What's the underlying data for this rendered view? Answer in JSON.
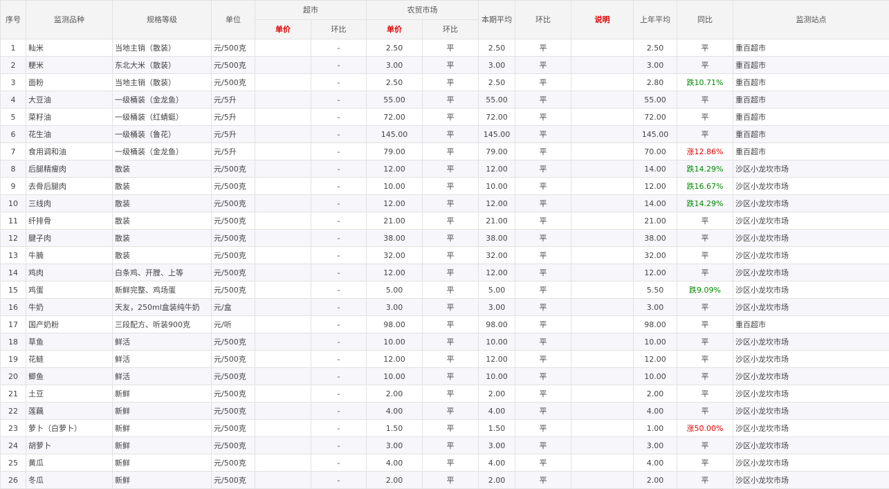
{
  "headers": {
    "seq": "序号",
    "variety": "监测品种",
    "spec": "规格等级",
    "unit": "单位",
    "supermarket": "超市",
    "farmers_market": "农贸市场",
    "current_avg": "本期平均",
    "mom": "环比",
    "note": "说明",
    "last_year_avg": "上年平均",
    "yoy": "同比",
    "station": "监测站点",
    "unit_price": "单价",
    "sub_mom": "环比"
  },
  "colors": {
    "accent_red": "#e00000",
    "down_green": "#008800",
    "header_bg": "#f4f4f4",
    "row_alt_bg": "#f6f6fb"
  },
  "rows": [
    {
      "seq": "1",
      "variety": "籼米",
      "spec": "当地主销（散装）",
      "unit": "元/500克",
      "sm_price": "",
      "sm_mom": "-",
      "fm_price": "2.50",
      "fm_mom": "平",
      "avg": "2.50",
      "mom": "平",
      "note": "",
      "ly_avg": "2.50",
      "yoy": "平",
      "yoy_dir": "flat",
      "station": "重百超市"
    },
    {
      "seq": "2",
      "variety": "粳米",
      "spec": "东北大米（散装）",
      "unit": "元/500克",
      "sm_price": "",
      "sm_mom": "-",
      "fm_price": "3.00",
      "fm_mom": "平",
      "avg": "3.00",
      "mom": "平",
      "note": "",
      "ly_avg": "3.00",
      "yoy": "平",
      "yoy_dir": "flat",
      "station": "重百超市"
    },
    {
      "seq": "3",
      "variety": "面粉",
      "spec": "当地主销（散装）",
      "unit": "元/500克",
      "sm_price": "",
      "sm_mom": "-",
      "fm_price": "2.50",
      "fm_mom": "平",
      "avg": "2.50",
      "mom": "平",
      "note": "",
      "ly_avg": "2.80",
      "yoy": "跌10.71%",
      "yoy_dir": "down",
      "station": "重百超市"
    },
    {
      "seq": "4",
      "variety": "大豆油",
      "spec": "一级桶装（金龙鱼）",
      "unit": "元/5升",
      "sm_price": "",
      "sm_mom": "-",
      "fm_price": "55.00",
      "fm_mom": "平",
      "avg": "55.00",
      "mom": "平",
      "note": "",
      "ly_avg": "55.00",
      "yoy": "平",
      "yoy_dir": "flat",
      "station": "重百超市"
    },
    {
      "seq": "5",
      "variety": "菜籽油",
      "spec": "一级桶装（红蜻蜓）",
      "unit": "元/5升",
      "sm_price": "",
      "sm_mom": "-",
      "fm_price": "72.00",
      "fm_mom": "平",
      "avg": "72.00",
      "mom": "平",
      "note": "",
      "ly_avg": "72.00",
      "yoy": "平",
      "yoy_dir": "flat",
      "station": "重百超市"
    },
    {
      "seq": "6",
      "variety": "花生油",
      "spec": "一级桶装（鲁花）",
      "unit": "元/5升",
      "sm_price": "",
      "sm_mom": "-",
      "fm_price": "145.00",
      "fm_mom": "平",
      "avg": "145.00",
      "mom": "平",
      "note": "",
      "ly_avg": "145.00",
      "yoy": "平",
      "yoy_dir": "flat",
      "station": "重百超市"
    },
    {
      "seq": "7",
      "variety": "食用调和油",
      "spec": "一级桶装（金龙鱼）",
      "unit": "元/5升",
      "sm_price": "",
      "sm_mom": "-",
      "fm_price": "79.00",
      "fm_mom": "平",
      "avg": "79.00",
      "mom": "平",
      "note": "",
      "ly_avg": "70.00",
      "yoy": "涨12.86%",
      "yoy_dir": "up",
      "station": "重百超市"
    },
    {
      "seq": "8",
      "variety": "后腿精瘦肉",
      "spec": "散装",
      "unit": "元/500克",
      "sm_price": "",
      "sm_mom": "-",
      "fm_price": "12.00",
      "fm_mom": "平",
      "avg": "12.00",
      "mom": "平",
      "note": "",
      "ly_avg": "14.00",
      "yoy": "跌14.29%",
      "yoy_dir": "down",
      "station": "沙区小龙坎市场"
    },
    {
      "seq": "9",
      "variety": "去骨后腿肉",
      "spec": "散装",
      "unit": "元/500克",
      "sm_price": "",
      "sm_mom": "-",
      "fm_price": "10.00",
      "fm_mom": "平",
      "avg": "10.00",
      "mom": "平",
      "note": "",
      "ly_avg": "12.00",
      "yoy": "跌16.67%",
      "yoy_dir": "down",
      "station": "沙区小龙坎市场"
    },
    {
      "seq": "10",
      "variety": "三线肉",
      "spec": "散装",
      "unit": "元/500克",
      "sm_price": "",
      "sm_mom": "-",
      "fm_price": "12.00",
      "fm_mom": "平",
      "avg": "12.00",
      "mom": "平",
      "note": "",
      "ly_avg": "14.00",
      "yoy": "跌14.29%",
      "yoy_dir": "down",
      "station": "沙区小龙坎市场"
    },
    {
      "seq": "11",
      "variety": "纤排骨",
      "spec": "散装",
      "unit": "元/500克",
      "sm_price": "",
      "sm_mom": "-",
      "fm_price": "21.00",
      "fm_mom": "平",
      "avg": "21.00",
      "mom": "平",
      "note": "",
      "ly_avg": "21.00",
      "yoy": "平",
      "yoy_dir": "flat",
      "station": "沙区小龙坎市场"
    },
    {
      "seq": "12",
      "variety": "腱子肉",
      "spec": "散装",
      "unit": "元/500克",
      "sm_price": "",
      "sm_mom": "-",
      "fm_price": "38.00",
      "fm_mom": "平",
      "avg": "38.00",
      "mom": "平",
      "note": "",
      "ly_avg": "38.00",
      "yoy": "平",
      "yoy_dir": "flat",
      "station": "沙区小龙坎市场"
    },
    {
      "seq": "13",
      "variety": "牛腩",
      "spec": "散装",
      "unit": "元/500克",
      "sm_price": "",
      "sm_mom": "-",
      "fm_price": "32.00",
      "fm_mom": "平",
      "avg": "32.00",
      "mom": "平",
      "note": "",
      "ly_avg": "32.00",
      "yoy": "平",
      "yoy_dir": "flat",
      "station": "沙区小龙坎市场"
    },
    {
      "seq": "14",
      "variety": "鸡肉",
      "spec": "白条鸡、开膛、上等",
      "unit": "元/500克",
      "sm_price": "",
      "sm_mom": "-",
      "fm_price": "12.00",
      "fm_mom": "平",
      "avg": "12.00",
      "mom": "平",
      "note": "",
      "ly_avg": "12.00",
      "yoy": "平",
      "yoy_dir": "flat",
      "station": "沙区小龙坎市场"
    },
    {
      "seq": "15",
      "variety": "鸡蛋",
      "spec": "新鲜完整、鸡场蛋",
      "unit": "元/500克",
      "sm_price": "",
      "sm_mom": "-",
      "fm_price": "5.00",
      "fm_mom": "平",
      "avg": "5.00",
      "mom": "平",
      "note": "",
      "ly_avg": "5.50",
      "yoy": "跌9.09%",
      "yoy_dir": "down",
      "station": "沙区小龙坎市场"
    },
    {
      "seq": "16",
      "variety": "牛奶",
      "spec": "天友，250ml盒装纯牛奶",
      "unit": "元/盒",
      "sm_price": "",
      "sm_mom": "-",
      "fm_price": "3.00",
      "fm_mom": "平",
      "avg": "3.00",
      "mom": "平",
      "note": "",
      "ly_avg": "3.00",
      "yoy": "平",
      "yoy_dir": "flat",
      "station": "沙区小龙坎市场"
    },
    {
      "seq": "17",
      "variety": "国产奶粉",
      "spec": "三段配方、听装900克",
      "unit": "元/听",
      "sm_price": "",
      "sm_mom": "-",
      "fm_price": "98.00",
      "fm_mom": "平",
      "avg": "98.00",
      "mom": "平",
      "note": "",
      "ly_avg": "98.00",
      "yoy": "平",
      "yoy_dir": "flat",
      "station": "重百超市"
    },
    {
      "seq": "18",
      "variety": "草鱼",
      "spec": "鲜活",
      "unit": "元/500克",
      "sm_price": "",
      "sm_mom": "-",
      "fm_price": "10.00",
      "fm_mom": "平",
      "avg": "10.00",
      "mom": "平",
      "note": "",
      "ly_avg": "10.00",
      "yoy": "平",
      "yoy_dir": "flat",
      "station": "沙区小龙坎市场"
    },
    {
      "seq": "19",
      "variety": "花鲢",
      "spec": "鲜活",
      "unit": "元/500克",
      "sm_price": "",
      "sm_mom": "-",
      "fm_price": "12.00",
      "fm_mom": "平",
      "avg": "12.00",
      "mom": "平",
      "note": "",
      "ly_avg": "12.00",
      "yoy": "平",
      "yoy_dir": "flat",
      "station": "沙区小龙坎市场"
    },
    {
      "seq": "20",
      "variety": "鲫鱼",
      "spec": "鲜活",
      "unit": "元/500克",
      "sm_price": "",
      "sm_mom": "-",
      "fm_price": "10.00",
      "fm_mom": "平",
      "avg": "10.00",
      "mom": "平",
      "note": "",
      "ly_avg": "10.00",
      "yoy": "平",
      "yoy_dir": "flat",
      "station": "沙区小龙坎市场"
    },
    {
      "seq": "21",
      "variety": "土豆",
      "spec": "新鲜",
      "unit": "元/500克",
      "sm_price": "",
      "sm_mom": "-",
      "fm_price": "2.00",
      "fm_mom": "平",
      "avg": "2.00",
      "mom": "平",
      "note": "",
      "ly_avg": "2.00",
      "yoy": "平",
      "yoy_dir": "flat",
      "station": "沙区小龙坎市场"
    },
    {
      "seq": "22",
      "variety": "莲藕",
      "spec": "新鲜",
      "unit": "元/500克",
      "sm_price": "",
      "sm_mom": "-",
      "fm_price": "4.00",
      "fm_mom": "平",
      "avg": "4.00",
      "mom": "平",
      "note": "",
      "ly_avg": "4.00",
      "yoy": "平",
      "yoy_dir": "flat",
      "station": "沙区小龙坎市场"
    },
    {
      "seq": "23",
      "variety": "萝卜（白萝卜）",
      "spec": "新鲜",
      "unit": "元/500克",
      "sm_price": "",
      "sm_mom": "-",
      "fm_price": "1.50",
      "fm_mom": "平",
      "avg": "1.50",
      "mom": "平",
      "note": "",
      "ly_avg": "1.00",
      "yoy": "涨50.00%",
      "yoy_dir": "up",
      "station": "沙区小龙坎市场"
    },
    {
      "seq": "24",
      "variety": "胡萝卜",
      "spec": "新鲜",
      "unit": "元/500克",
      "sm_price": "",
      "sm_mom": "-",
      "fm_price": "3.00",
      "fm_mom": "平",
      "avg": "3.00",
      "mom": "平",
      "note": "",
      "ly_avg": "3.00",
      "yoy": "平",
      "yoy_dir": "flat",
      "station": "沙区小龙坎市场"
    },
    {
      "seq": "25",
      "variety": "黄瓜",
      "spec": "新鲜",
      "unit": "元/500克",
      "sm_price": "",
      "sm_mom": "-",
      "fm_price": "4.00",
      "fm_mom": "平",
      "avg": "4.00",
      "mom": "平",
      "note": "",
      "ly_avg": "4.00",
      "yoy": "平",
      "yoy_dir": "flat",
      "station": "沙区小龙坎市场"
    },
    {
      "seq": "26",
      "variety": "冬瓜",
      "spec": "新鲜",
      "unit": "元/500克",
      "sm_price": "",
      "sm_mom": "-",
      "fm_price": "2.00",
      "fm_mom": "平",
      "avg": "2.00",
      "mom": "平",
      "note": "",
      "ly_avg": "2.00",
      "yoy": "平",
      "yoy_dir": "flat",
      "station": "沙区小龙坎市场"
    }
  ]
}
